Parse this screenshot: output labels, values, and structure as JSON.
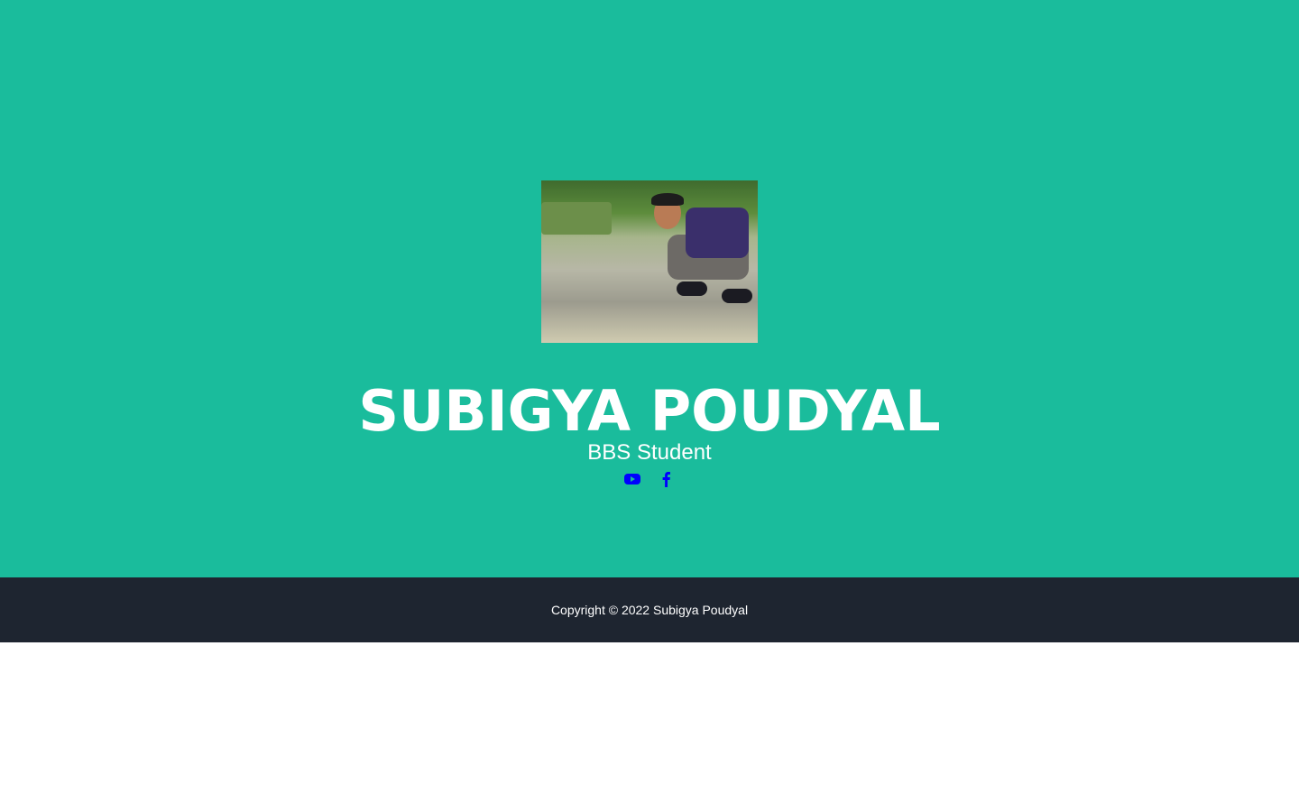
{
  "profile": {
    "name": "SUBIGYA POUDYAL",
    "subtitle": "BBS Student",
    "photo_alt": "Subigya Poudyal crouching by a stream"
  },
  "social": [
    {
      "icon": "youtube-icon",
      "color": "#0000ff"
    },
    {
      "icon": "facebook-icon",
      "color": "#0000ff"
    }
  ],
  "footer": {
    "copyright": "Copyright © 2022 Subigya Poudyal"
  },
  "colors": {
    "masthead": "#1abc9c",
    "footer": "#1e2530"
  }
}
